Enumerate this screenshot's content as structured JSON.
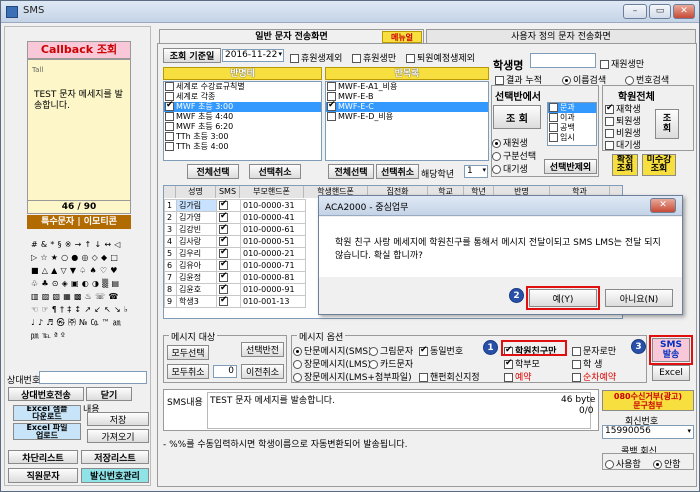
{
  "window": {
    "title": "SMS",
    "btn_min": "–",
    "btn_max": "▭",
    "btn_close": "✕"
  },
  "left": {
    "callback_title": "Callback 조회",
    "signal": "Tall",
    "message": "TEST 문자 메세지를 발송합니다.",
    "counter": "46 / 90",
    "special_label": "특수문자 | 이모티콘",
    "symbols": "#&*§※→↑↓↔◁▷☆★○●◎◇◆□■△▲▽▼♤♠♡♥♧♣⊙◈▣◐◑▒▤▥▨▧▦▩♨☏☎☜☞¶†‡↕↗↙↖↘♭♩♪♬㉿㈜№㏇™㏂㏘℡ªº",
    "sangdaebeon_label": "상대번호",
    "btn_sangdae_send": "상대번호전송",
    "btn_close": "닫기",
    "btn_excel_sample": "Excel 샘플\n다운로드",
    "btn_excel_upload": "Excel 파일\n업로드",
    "content_label": "내용",
    "btn_save": "저장",
    "btn_load": "가져오기",
    "btn_block_list": "차단리스트",
    "btn_save_list": "저장리스트",
    "btn_staff_sms": "직원문자",
    "btn_sender_mgmt": "발신번호관리"
  },
  "tabs": {
    "general": "일반 문자 전송화면",
    "manual": "메뉴얼",
    "custom": "사용자 정의 문자 전송화면"
  },
  "filters": {
    "btn_query_date": "조회 기준일",
    "date": "2016-11-22",
    "chk_exclude_leave": "휴원생제외",
    "chk_leave_only": "휴원생만",
    "chk_exclude_planned": "퇴원예정생제외"
  },
  "class_list": {
    "header": "반명테",
    "items": [
      "세계로 수강료규칙별",
      "세계로 각종",
      "MWF 초등 3:00",
      "MWF 초등 4:40",
      "MWF 초등 6:20",
      "TTh 초등 3:00",
      "TTh 초등 4:00"
    ],
    "btn_select_all": "전체선택",
    "btn_deselect_all": "선택취소"
  },
  "group_list": {
    "header": "반목록",
    "items": [
      "MWF-E-A1_비용",
      "MWF-E-B",
      "MWF-E-C",
      "MWF-E-D_비용"
    ],
    "btn_select_all": "전체선택",
    "btn_deselect_all": "선택취소",
    "grade_label": "해당학년",
    "grade_value": "1"
  },
  "student_search": {
    "name_label": "학생명",
    "chk_reenroll_only": "재원생만",
    "chk_result_accum": "결과 누적",
    "radio_name": "이름검색",
    "radio_number": "번호검색"
  },
  "class_select": {
    "title": "선택반에서",
    "btn_query": "조 회",
    "radio_enrolled": "재원생",
    "radio_class_select": "구분선택",
    "radio_waiting": "대기생",
    "options": [
      "문과",
      "이과",
      "공백",
      "임시"
    ],
    "btn_deselect_class": "선택반제외"
  },
  "academy": {
    "title": "학원전체",
    "chk_enrolled": "재학생",
    "chk_withdrawn": "퇴원생",
    "chk_nonenrolled": "비원생",
    "chk_waiting": "대기생",
    "btn_query": "조\n회",
    "btn_confirm_query": "확정\n조회",
    "btn_unconfirmed_query": "미수강\n조회"
  },
  "table": {
    "headers": [
      "",
      "성명",
      "SMS",
      "부모핸드폰",
      "학생핸드폰",
      "집전화",
      "학교",
      "학년",
      "반명",
      "학과"
    ],
    "rows": [
      {
        "no": "1",
        "name": "김가림",
        "phone": "010-0000-31"
      },
      {
        "no": "2",
        "name": "김가영",
        "phone": "010-0000-41"
      },
      {
        "no": "3",
        "name": "김강빈",
        "phone": "010-0000-61"
      },
      {
        "no": "4",
        "name": "김사랑",
        "phone": "010-0000-51"
      },
      {
        "no": "5",
        "name": "김우리",
        "phone": "010-0000-21"
      },
      {
        "no": "6",
        "name": "김유아",
        "phone": "010-0000-71"
      },
      {
        "no": "7",
        "name": "김윤정",
        "phone": "010-0000-81"
      },
      {
        "no": "8",
        "name": "김윤호",
        "phone": "010-0000-91"
      },
      {
        "no": "9",
        "name": "학생3",
        "phone": "010-001-13"
      }
    ]
  },
  "dialog": {
    "title": "ACA2000 - 중심업무",
    "message": "학원 친구 사랑 메세지에 학원친구를 통해서 메시지 전달이되고 SMS LMS는 전달 되지 않습니다. 확실 합니까?",
    "btn_yes": "예(Y)",
    "btn_no": "아니요(N)",
    "badge_yes": "2"
  },
  "target": {
    "title": "메시지 대상",
    "btn_select_all": "모두선택",
    "btn_invert": "선택반전",
    "btn_cancel_all": "모두취소",
    "count": "0",
    "btn_prev_cancel": "이전취소"
  },
  "options": {
    "title": "메시지 옵션",
    "radio_sms": "단문메시지(SMS)",
    "radio_image": "그림문자",
    "chk_same_number": "동일번호",
    "radio_lms": "장문메시지(LMS)",
    "radio_card": "카드문자",
    "radio_lms_attach": "장문메시지(LMS+첨부파일)",
    "chk_parent_reply": "핸펀회신지정",
    "chk_reservation": "예약",
    "chk_academy_friend": "학원친구만",
    "badge_friend": "1",
    "chk_parent": "학부모",
    "chk_text_only": "문자로만",
    "chk_student": "학 생",
    "chk_sequential": "순차예약"
  },
  "send": {
    "btn_sms_send": "SMS\n발송",
    "badge_send": "3",
    "btn_excel": "Excel"
  },
  "compose": {
    "label": "SMS내용",
    "text": "TEST 문자 메세지를 발송합니다.",
    "bytes": "46 byte",
    "bytes_sub": "0/0",
    "hint": "- %%를 수동입력하시면 학생이름으로 자동변환되어 발송됩니다."
  },
  "reply": {
    "btn_080": "080수신거부(광고)\n문구첨부",
    "label": "회신번호",
    "value": "15990056",
    "callback_label": "콜백 회신",
    "radio_use": "사용함",
    "radio_nouse": "안함"
  },
  "colors": {
    "accent_red": "#e01010",
    "tab_active": "#f0f0f0",
    "header_yellow": "#f7df3f",
    "pink": "#f9c8d8",
    "teal_btn": "#8fe2e6",
    "badge_blue": "#2850a8"
  }
}
